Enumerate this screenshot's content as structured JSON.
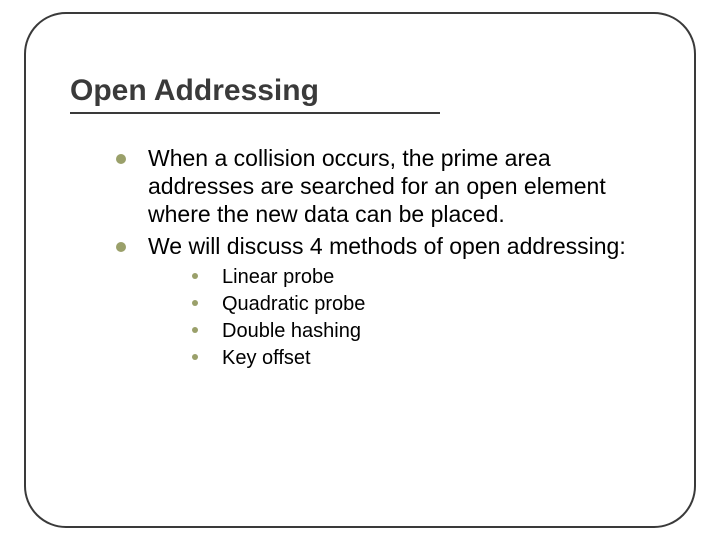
{
  "title": "Open Addressing",
  "bullets": {
    "b0": "When a collision occurs, the prime area addresses are searched for an open element where the new data can be placed.",
    "b1": "We will discuss 4 methods of open addressing:"
  },
  "sub_bullets": {
    "s0": "Linear probe",
    "s1": "Quadratic probe",
    "s2": "Double hashing",
    "s3": "Key offset"
  }
}
